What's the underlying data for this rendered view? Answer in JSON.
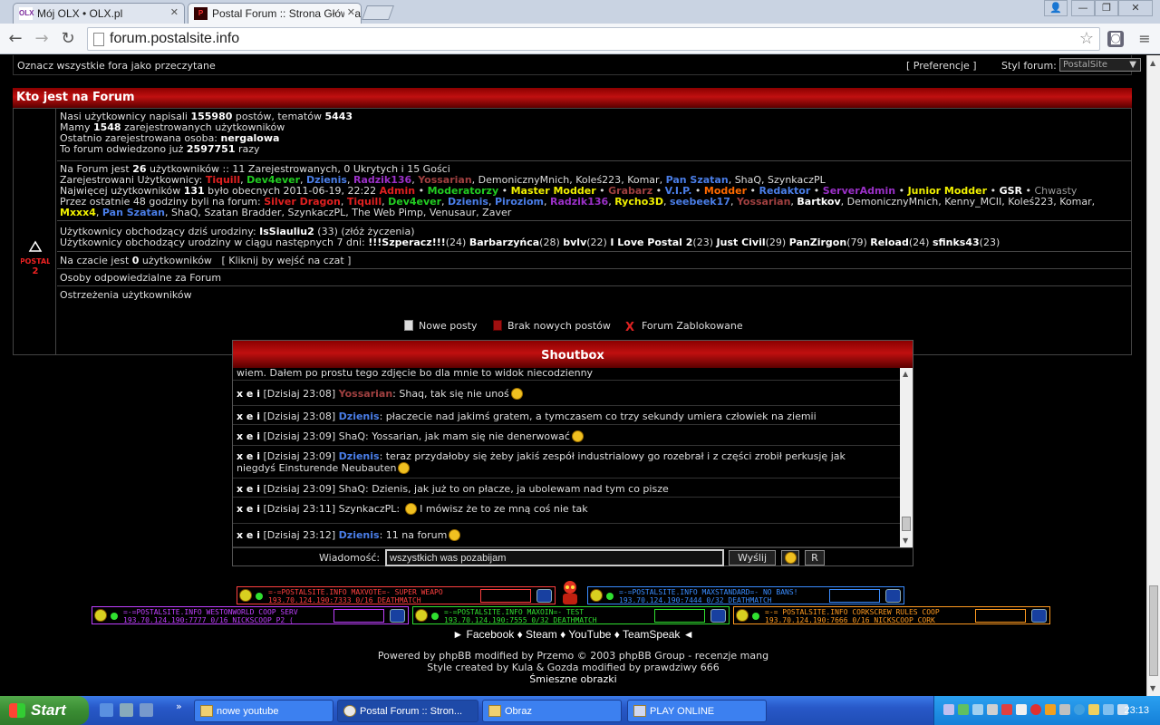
{
  "browser": {
    "tabs": [
      {
        "title": "Mój OLX • OLX.pl",
        "favicon": "OLX"
      },
      {
        "title": "Postal Forum :: Strona Główna",
        "favicon": "P"
      }
    ],
    "url": "forum.postalsite.info"
  },
  "topline": {
    "mark_all": "Oznacz wszystkie fora jako przeczytane",
    "preferences": "[ Preferencje ]",
    "style_label": "Styl forum:",
    "style_value": "PostalSite"
  },
  "who": {
    "header": "Kto jest na Forum",
    "stats": {
      "l1a": "Nasi użytkownicy napisali ",
      "posts": "155980",
      "l1b": " postów, tematów ",
      "topics": "5443",
      "l2a": "Mamy ",
      "users": "1548",
      "l2b": " zarejestrowanych użytkowników",
      "l3a": "Ostatnio zarejestrowana osoba: ",
      "newest": "nergalowa",
      "l4a": "To forum odwiedzono już ",
      "visits": "2597751",
      "l4b": " razy"
    },
    "online": {
      "l1a": "Na Forum jest ",
      "count": "26",
      "l1b": " użytkowników :: 11 Zarejestrowanych, 0 Ukrytych i 15 Gości",
      "reg_label": "Zarejestrowani Użytkownicy: ",
      "registered": [
        {
          "n": "Tiquill",
          "c": "red"
        },
        {
          "n": "Dev4ever",
          "c": "green"
        },
        {
          "n": "Dzienis",
          "c": "blue"
        },
        {
          "n": "Radzik136",
          "c": "purple"
        },
        {
          "n": "Yossarian",
          "c": "brown"
        },
        {
          "n": "DemonicznyMnich",
          "c": "plain"
        },
        {
          "n": "Koleś223",
          "c": "plain"
        },
        {
          "n": "Komar",
          "c": "plain"
        },
        {
          "n": "Pan Szatan",
          "c": "blue"
        },
        {
          "n": "ShaQ",
          "c": "plain"
        },
        {
          "n": "SzynkaczPL",
          "c": "plain"
        }
      ],
      "record_a": "Najwięcej użytkowników ",
      "record": "131",
      "record_b": " było obecnych 2011-06-19, 22:22 ",
      "groups": [
        {
          "n": "Admin",
          "c": "red"
        },
        {
          "n": "Moderatorzy",
          "c": "green"
        },
        {
          "n": "Master Modder",
          "c": "yellow"
        },
        {
          "n": "Grabarz",
          "c": "brown"
        },
        {
          "n": "V.I.P.",
          "c": "blue"
        },
        {
          "n": "Modder",
          "c": "orange"
        },
        {
          "n": "Redaktor",
          "c": "blue"
        },
        {
          "n": "ServerAdmin",
          "c": "purple"
        },
        {
          "n": "Junior Modder",
          "c": "yellow"
        },
        {
          "n": "GSR",
          "c": "white"
        },
        {
          "n": "Chwasty",
          "c": "grey"
        }
      ],
      "last48_label": "Przez ostatnie 48 godziny byli na forum: ",
      "last48": [
        {
          "n": "Silver Dragon",
          "c": "red"
        },
        {
          "n": "Tiquill",
          "c": "red"
        },
        {
          "n": "Dev4ever",
          "c": "green"
        },
        {
          "n": "Dzienis",
          "c": "blue"
        },
        {
          "n": "Piroziom",
          "c": "blue"
        },
        {
          "n": "Radzik136",
          "c": "purple"
        },
        {
          "n": "Rycho3D",
          "c": "yellow"
        },
        {
          "n": "seebeek17",
          "c": "blue"
        },
        {
          "n": "Yossarian",
          "c": "brown"
        },
        {
          "n": "Bartkov",
          "c": "white"
        },
        {
          "n": "DemonicznyMnich",
          "c": "plain"
        },
        {
          "n": "Kenny_MCII",
          "c": "plain"
        },
        {
          "n": "Koleś223",
          "c": "plain"
        },
        {
          "n": "Komar",
          "c": "plain"
        },
        {
          "n": "Mxxx4",
          "c": "yellow"
        },
        {
          "n": "Pan Szatan",
          "c": "blue"
        },
        {
          "n": "ShaQ",
          "c": "plain"
        },
        {
          "n": "Szatan Bradder",
          "c": "plain"
        },
        {
          "n": "SzynkaczPL",
          "c": "plain"
        },
        {
          "n": "The Web Pimp",
          "c": "plain"
        },
        {
          "n": "Venusaur",
          "c": "plain"
        },
        {
          "n": "Zaver",
          "c": "plain"
        }
      ]
    },
    "birthdays": {
      "today_label": "Użytkownicy obchodzący dziś urodziny: ",
      "today_user": "IsSiauliu2",
      "today_rest": " (33) (złóż życzenia)",
      "week_label": "Użytkownicy obchodzący urodziny w ciągu następnych 7 dni: ",
      "week": [
        {
          "n": "!!!Szperacz!!!",
          "a": "(24)"
        },
        {
          "n": "Barbarzyńca",
          "a": "(28)"
        },
        {
          "n": "bvlv",
          "a": "(22)"
        },
        {
          "n": "I Love Postal 2",
          "a": "(23)"
        },
        {
          "n": "Just Civil",
          "a": "(29)"
        },
        {
          "n": "PanZirgon",
          "a": "(79)"
        },
        {
          "n": "Reload",
          "a": "(24)"
        },
        {
          "n": "sfinks43",
          "a": "(23)"
        }
      ]
    },
    "chat_a": "Na czacie jest ",
    "chat_count": "0",
    "chat_b": " użytkowników",
    "chat_link": "[ Kliknij by wejść na czat ]",
    "responsible": "Osoby odpowiedzialne za Forum",
    "warnings": "Ostrzeżenia użytkowników"
  },
  "legend": {
    "new_posts": "Nowe posty",
    "no_new": "Brak nowych postów",
    "locked": "Forum Zablokowane"
  },
  "shoutbox": {
    "title": "Shoutbox",
    "messages": [
      {
        "text": "wiem. Dałem po prostu tego zdjęcie bo dla mnie to widok niecodzienny"
      },
      {
        "time": "[Dzisiaj 23:08]",
        "user": "Yossarian",
        "c": "brown",
        "text": ": Shaq, tak się nie unoś",
        "smile": true
      },
      {
        "time": "[Dzisiaj 23:08]",
        "user": "Dzienis",
        "c": "blue",
        "text": ": płaczecie nad jakimś gratem, a tymczasem co trzy sekundy umiera człowiek na ziemii"
      },
      {
        "time": "[Dzisiaj 23:09]",
        "user": "ShaQ",
        "c": "plain",
        "text": ": Yossarian, jak mam się nie denerwować",
        "smile": true
      },
      {
        "time": "[Dzisiaj 23:09]",
        "user": "Dzienis",
        "c": "blue",
        "text": ": teraz przydałoby się żeby jakiś zespół industrialowy go rozebrał i z części zrobił perkusję jak",
        "text2": "niegdyś Einsturende Neubauten",
        "smile": true
      },
      {
        "time": "[Dzisiaj 23:09]",
        "user": "ShaQ",
        "c": "plain",
        "text": ": Dzienis, jak już to on płacze, ja ubolewam nad tym co pisze"
      },
      {
        "time": "[Dzisiaj 23:11]",
        "user": "SzynkaczPL",
        "c": "plain",
        "text": ": ",
        "text_after": " I mówisz że to ze mną coś nie tak",
        "smile_before": true
      },
      {
        "time": "[Dzisiaj 23:12]",
        "user": "Dzienis",
        "c": "blue",
        "text": ": 11 na forum",
        "smile": true
      }
    ],
    "delete_marker": "x e i",
    "input_label": "Wiadomość:",
    "input_value": "wszystkich was pozabijam",
    "send": "Wyślij",
    "refresh": "R"
  },
  "servers": [
    {
      "t1": "=-=POSTALSITE.INFO MAXVOTE=- SUPER WEAPO",
      "t2": "193.70.124.190:7333    0/16     DEATHMATCH",
      "color": "#ff4040"
    },
    {
      "t1": "=-=POSTALSITE.INFO MAXSTANDARD=- NO BANS!",
      "t2": "193.70.124.190:7444    0/32     DEATHMATCH",
      "color": "#3a8cff"
    },
    {
      "t1": "=-=POSTALSITE.INFO WESTONWORLD COOP SERV",
      "t2": "193.70.124.190:7777   0/16     NICKSCOOP P2 (",
      "color": "#c040ff"
    },
    {
      "t1": "=-=POSTALSITE.INFO MAXOIN=- TEST",
      "t2": "193.70.124.190:7555    0/32     DEATHMATCH",
      "color": "#30e030"
    },
    {
      "t1": "=-= POSTALSITE.INFO CORKSCREW RULES COOP",
      "t2": "193.70.124.190:7666   0/16     NICKSCOOP CORK",
      "color": "#ff9a20"
    }
  ],
  "footer": {
    "links": [
      "Facebook",
      "Steam",
      "YouTube",
      "TeamSpeak"
    ],
    "powered": "Powered by phpBB modified by Przemo © 2003 phpBB Group - recenzje mang",
    "style": "Style created by Kula & Gozda modified by prawdziwy 666",
    "funny": "Śmieszne obrazki"
  },
  "taskbar": {
    "start": "Start",
    "tasks": [
      "nowe youtube",
      "Postal Forum :: Stron...",
      "Obraz",
      "PLAY ONLINE"
    ],
    "clock": "23:13"
  }
}
